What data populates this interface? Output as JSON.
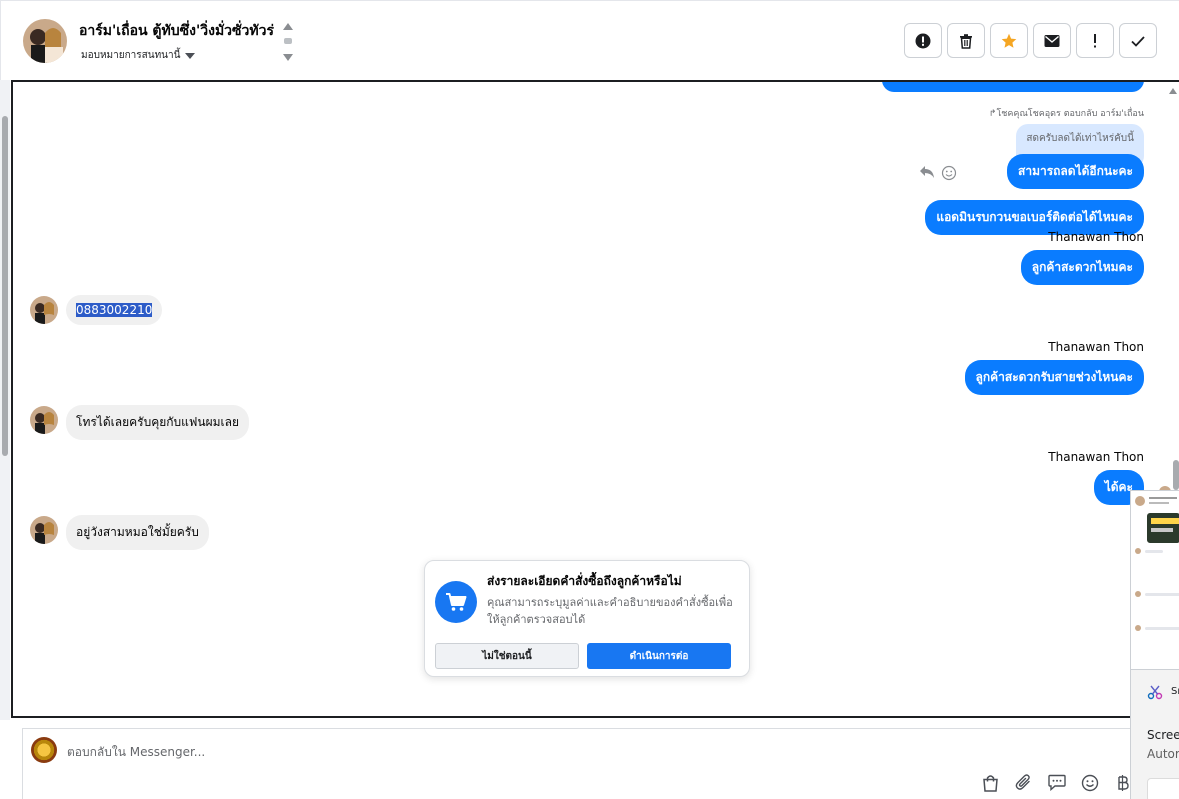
{
  "header": {
    "contact_name": "อาร์ม'เถื่อน ตู้ทับซึ่ง'วิ่งมั่วซั่วทัวร่",
    "assign_label": "มอบหมายการสนทนานี้",
    "toolbar": [
      "alert-icon",
      "trash-icon",
      "star-icon",
      "envelope-icon",
      "exclamation-icon",
      "check-icon"
    ],
    "star_color": "#f5a623"
  },
  "thread": {
    "reply_meta": "โชคคุณโชคอุดร ตอบกลับ อาร์ม'เถื่อน",
    "quoted_text": "สดครับลดได้เท่าไหร่คับนี้",
    "messages": [
      {
        "dir": "out",
        "text": "สามารถลดได้อีกนะคะ"
      },
      {
        "dir": "out",
        "text": "แอดมินรบกวนขอเบอร์ติดต่อได้ไหมคะ"
      },
      {
        "dir": "out",
        "sender": "Thanawan Thon",
        "text": "ลูกค้าสะดวกไหมคะ"
      },
      {
        "dir": "in",
        "text": "0883002210"
      },
      {
        "dir": "out",
        "sender": "Thanawan Thon",
        "text": "ลูกค้าสะดวกรับสายช่วงไหนคะ"
      },
      {
        "dir": "in",
        "text": "โทรได้เลยครับคุยกับแฟนผมเลย"
      },
      {
        "dir": "out",
        "sender": "Thanawan Thon",
        "text": "ได้คะ"
      },
      {
        "dir": "in",
        "text": "อยู่วังสามหมอใช่มั้ยครับ"
      }
    ]
  },
  "order_card": {
    "title": "ส่งรายละเอียดคำสั่งซื้อถึงลูกค้าหรือไม่",
    "description": "คุณสามารถระบุมูลค่าและคำอธิบายของคำสั่งซื้อเพื่อให้ลูกค้าตรวจสอบได้",
    "secondary_button": "ไม่ใช่ตอนนี้",
    "primary_button": "ดำเนินการต่อ"
  },
  "composer": {
    "placeholder": "ตอบกลับใน Messenger...",
    "tools": [
      "shopping-bag-icon",
      "paperclip-icon",
      "saved-reply-icon",
      "emoji-icon",
      "baht-icon"
    ]
  },
  "overlay": {
    "panel_title": "Sn",
    "line1": "Scree",
    "line2": "Autor"
  },
  "colors": {
    "accent": "#0a7cff",
    "primary_button": "#1877f2"
  }
}
